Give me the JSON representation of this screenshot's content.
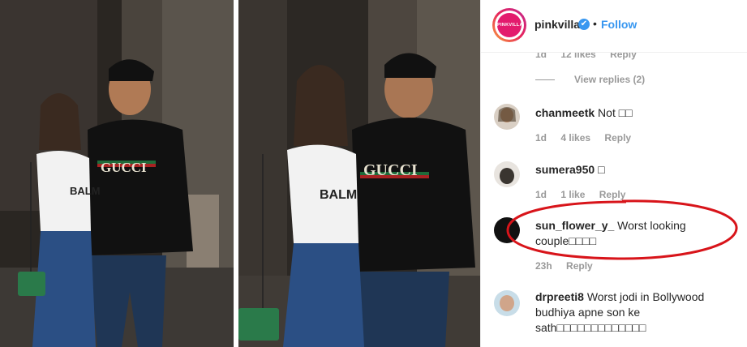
{
  "post": {
    "account": "pinkvilla",
    "avatar_text": "PINKVILLA",
    "verified_icon": "✔",
    "separator": "•",
    "follow_label": "Follow",
    "photo1_shirt_text": "GUCCI",
    "photo1_top_text": "BALM",
    "photo2_shirt_text": "GUCCI",
    "photo2_top_text": "BALM"
  },
  "prev_meta": {
    "time": "1d",
    "likes": "12 likes",
    "reply": "Reply"
  },
  "view_replies": "View replies (2)",
  "comments": [
    {
      "user": "chanmeetk",
      "text": "Not □□",
      "time": "1d",
      "likes": "4 likes",
      "reply": "Reply"
    },
    {
      "user": "sumera950",
      "text": "□",
      "time": "1d",
      "likes": "1 like",
      "reply": "Reply"
    },
    {
      "user": "sun_flower_y_",
      "text": "Worst looking couple□□□□",
      "time": "23h",
      "likes": "",
      "reply": "Reply"
    },
    {
      "user": "drpreeti8",
      "text": "Worst jodi in Bollywood budhiya apne son ke sath□□□□□□□□□□□□□",
      "time": "",
      "likes": "",
      "reply": ""
    }
  ],
  "colors": {
    "accent": "#3897f0",
    "highlight": "#d8141a",
    "brand": "#e31b6d"
  }
}
